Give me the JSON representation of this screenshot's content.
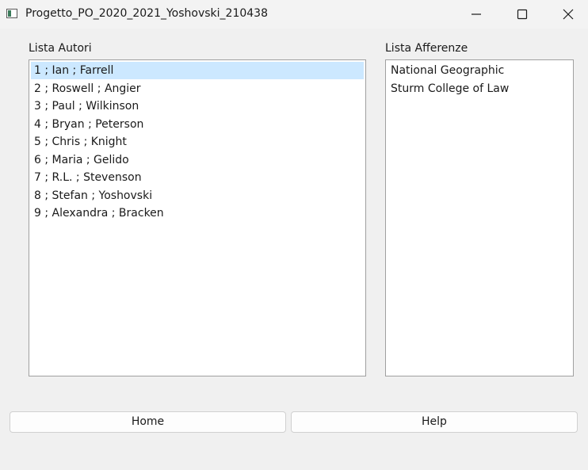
{
  "window": {
    "title": "Progetto_PO_2020_2021_Yoshovski_210438"
  },
  "authors": {
    "label": "Lista Autori",
    "items": [
      "1 ; Ian ; Farrell",
      "2 ; Roswell ; Angier",
      "3 ; Paul ; Wilkinson",
      "4 ; Bryan ; Peterson",
      "5 ; Chris ; Knight",
      "6 ; Maria ; Gelido",
      "7 ; R.L. ; Stevenson",
      "8 ; Stefan ; Yoshovski",
      "9 ; Alexandra ; Bracken"
    ],
    "selected_index": 0
  },
  "affiliations": {
    "label": "Lista Afferenze",
    "items": [
      "National Geographic",
      "Sturm College of Law"
    ]
  },
  "buttons": {
    "home_label": "Home",
    "help_label": "Help"
  },
  "colors": {
    "selection": "#cce8ff",
    "window_bg": "#f0f0f0",
    "list_bg": "#ffffff"
  }
}
